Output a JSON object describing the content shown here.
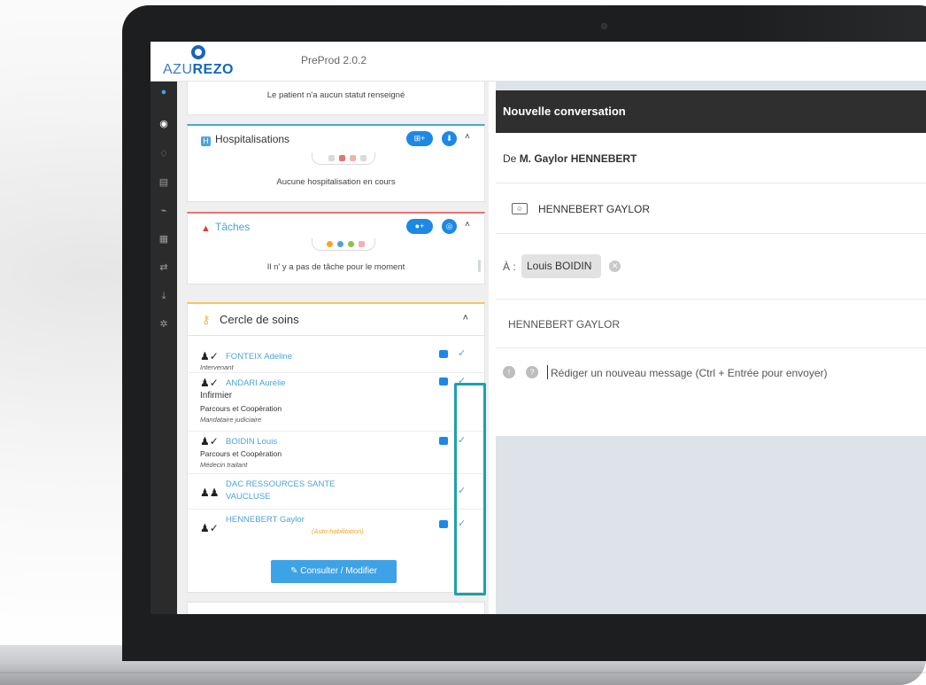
{
  "app": {
    "logo_text_light": "AZU",
    "logo_text_bold": "REZO",
    "version": "PreProd 2.0.2"
  },
  "sidebar": {
    "icons": [
      "user-icon",
      "azurezo-icon",
      "bell-icon",
      "calendar-icon",
      "chart-icon",
      "table-icon",
      "share-icon",
      "download-icon",
      "settings-icon"
    ]
  },
  "status_card": {
    "text": "Le patient n'a aucun statut renseigné"
  },
  "hospitalisations": {
    "title": "Hospitalisations",
    "message": "Aucune hospitalisation en cours",
    "button_add": "⊞+",
    "button_second": "⬇",
    "caret": "˄"
  },
  "taches": {
    "title": "Tâches",
    "message": "Il n' y a pas de tâche pour le moment",
    "button_add": "●+",
    "button_second": "◎",
    "caret": "˄"
  },
  "cercle": {
    "title": "Cercle de soins",
    "caret": "˄",
    "members": [
      {
        "name": "FONTEIX Adeline",
        "lines": [
          "Intervenant"
        ]
      },
      {
        "name": "ANDARI Aurélie",
        "lines": [
          "Infirmier",
          "Parcours et Coopération",
          "Mandataire judiciaire"
        ]
      },
      {
        "name": "BOIDIN Louis",
        "lines": [
          "Parcours et Coopération",
          "Médecin traitant"
        ]
      },
      {
        "name_1": "DAC RESSOURCES SANTE",
        "name_2": "VAUCLUSE"
      },
      {
        "name": "HENNEBERT Gaylor",
        "auto": "(Auto-habilitation)"
      }
    ],
    "consult_button": "Consulter / Modifier"
  },
  "conversation": {
    "header": "Nouvelle conversation",
    "from_prefix": "De",
    "from_name": "M. Gaylor HENNEBERT",
    "identity": "HENNEBERT GAYLOR",
    "to_label": "À :",
    "to_chip": "Louis BOIDIN",
    "subject": "HENNEBERT GAYLOR",
    "message_placeholder": "Rédiger un nouveau message (Ctrl + Entrée pour envoyer)"
  },
  "colors": {
    "accent_blue": "#1e88e5",
    "highlight_teal": "#1aa3a8",
    "task_red": "#e57373",
    "cercle_yellow": "#f6c65b",
    "header_dark": "#2f2f2f"
  }
}
